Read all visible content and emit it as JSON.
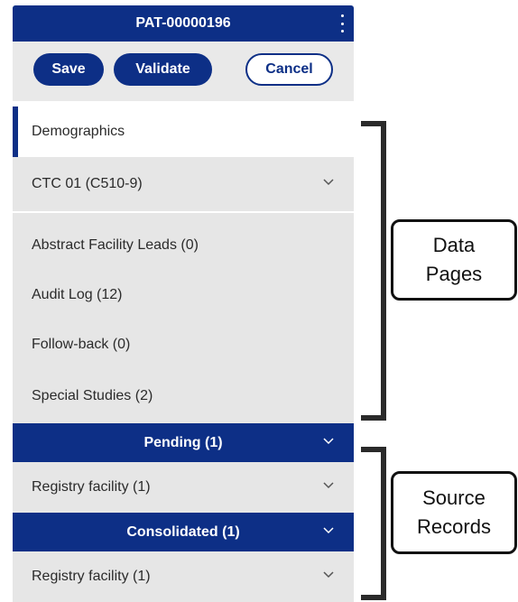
{
  "header": {
    "title": "PAT-00000196",
    "menu_icon": "kebab-menu-icon"
  },
  "actions": {
    "save": "Save",
    "validate": "Validate",
    "cancel": "Cancel"
  },
  "nav": {
    "items": [
      "Demographics",
      "CTC 01  (C510-9)",
      "Abstract Facility Leads (0)",
      "Audit Log (12)",
      "Follow-back (0)",
      "Special Studies (2)"
    ]
  },
  "sections": {
    "pending": {
      "title": "Pending (1)",
      "item": "Registry facility  (1)"
    },
    "consolidated": {
      "title": "Consolidated (1)",
      "item": "Registry facility  (1)"
    }
  },
  "annotations": {
    "data_pages": [
      "Data",
      "Pages"
    ],
    "source_records": [
      "Source",
      "Records"
    ]
  },
  "colors": {
    "primary": "#0d2f86",
    "row_bg": "#e6e6e6",
    "bracket": "#2a2a2a"
  }
}
